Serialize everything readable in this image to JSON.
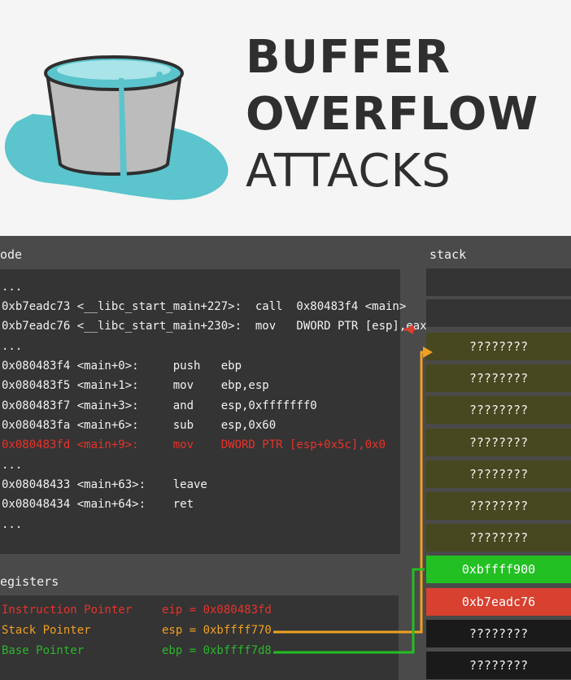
{
  "banner": {
    "title_line1": "BUFFER",
    "title_line2": "OVERFLOW",
    "title_line3": "ATTACKS",
    "colors": {
      "water": "#5bc4cc",
      "bucket": "#bcbcbc",
      "text": "#2f2f2f"
    }
  },
  "code_section": {
    "label": "ode",
    "lines": [
      {
        "text": "..."
      },
      {
        "text": "0xb7eadc73 <__libc_start_main+227>:  call  0x80483f4 <main>"
      },
      {
        "text": "0xb7eadc76 <__libc_start_main+230>:  mov   DWORD PTR [esp],eax"
      },
      {
        "text": "..."
      },
      {
        "text": "0x080483f4 <main+0>:     push   ebp"
      },
      {
        "text": "0x080483f5 <main+1>:     mov    ebp,esp"
      },
      {
        "text": "0x080483f7 <main+3>:     and    esp,0xfffffff0"
      },
      {
        "text": "0x080483fa <main+6>:     sub    esp,0x60"
      },
      {
        "text": "0x080483fd <main+9>:     mov    DWORD PTR [esp+0x5c],0x0",
        "highlight": true
      },
      {
        "text": "..."
      },
      {
        "text": "0x08048433 <main+63>:    leave"
      },
      {
        "text": "0x08048434 <main+64>:    ret"
      },
      {
        "text": "..."
      }
    ]
  },
  "registers_section": {
    "label": "egisters",
    "rows": [
      {
        "name": "Instruction Pointer",
        "value": "eip = 0x080483fd",
        "color": "#e8322a"
      },
      {
        "name": "Stack Pointer",
        "value": "esp = 0xbffff770",
        "color": "#f0a020"
      },
      {
        "name": "Base Pointer",
        "value": "ebp = 0xbffff7d8",
        "color": "#2cb52c"
      }
    ]
  },
  "stack_section": {
    "label": "stack",
    "cells": [
      {
        "text": "????????",
        "kind": "olive"
      },
      {
        "text": "????????",
        "kind": "olive"
      },
      {
        "text": "????????",
        "kind": "olive"
      },
      {
        "text": "????????",
        "kind": "olive"
      },
      {
        "text": "????????",
        "kind": "olive"
      },
      {
        "text": "????????",
        "kind": "olive"
      },
      {
        "text": "????????",
        "kind": "olive"
      },
      {
        "text": "0xbffff900",
        "kind": "green"
      },
      {
        "text": "0xb7eadc76",
        "kind": "red"
      },
      {
        "text": "????????",
        "kind": "black"
      },
      {
        "text": "????????",
        "kind": "black"
      }
    ]
  }
}
